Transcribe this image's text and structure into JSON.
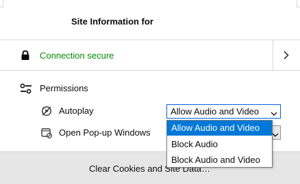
{
  "header": {
    "title": "Site Information for"
  },
  "connection": {
    "label": "Connection secure",
    "status_color": "#058b00",
    "lock_icon": "lock-icon",
    "expand_icon": "chevron-right-icon"
  },
  "permissions": {
    "heading": "Permissions",
    "heading_icon": "permissions-sliders-icon",
    "items": [
      {
        "label": "Autoplay",
        "icon": "autoplay-icon",
        "selected": "Allow Audio and Video"
      },
      {
        "label": "Open Pop-up Windows",
        "icon": "popup-window-icon"
      }
    ]
  },
  "dropdown": {
    "options": [
      {
        "label": "Allow Audio and Video",
        "selected": true
      },
      {
        "label": "Block Audio",
        "selected": false
      },
      {
        "label": "Block Audio and Video",
        "selected": false
      }
    ],
    "highlight_color": "#0078d7"
  },
  "footer": {
    "button_label": "Clear Cookies and Site Data…"
  }
}
